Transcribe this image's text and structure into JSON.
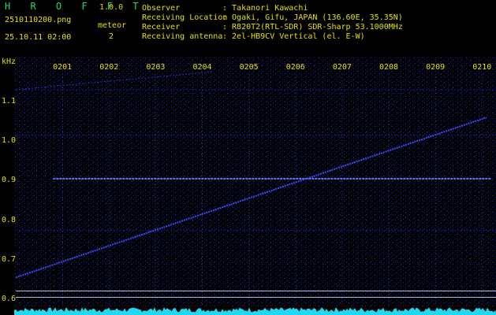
{
  "header": {
    "app_name": "H R O F F T",
    "version": "1.0.0",
    "filename": "2510110200.png",
    "datetime": "25.10.11 02:00",
    "meteor_label": "meteor",
    "meteor_count": "2",
    "info": [
      {
        "label": "Observer",
        "value": ": Takanori Kawachi"
      },
      {
        "label": "Receiving Location",
        "value": ": Ogaki, Gifu, JAPAN (136.60E, 35.35N)"
      },
      {
        "label": "Receiver",
        "value": ": R820T2(RTL-SDR) SDR-Sharp 53.1000MHz"
      },
      {
        "label": "Receiving antenna",
        "value": ": 2el-HB9CV Vertical (el. E-W)"
      }
    ]
  },
  "colors": {
    "background": "#000000",
    "label_text": "#e6e000",
    "title_green": "#23d96f",
    "signal_blue": "#3a4cff",
    "grid_purple": "#5a3fc0",
    "baseline_cyan": "#20d8f0"
  },
  "chart_data": {
    "type": "heatmap",
    "y_unit_label": "kHz",
    "y_ticks": [
      "1.1",
      "1.0",
      "0.9",
      "0.8",
      "0.7",
      "0.6"
    ],
    "y_tick_values": [
      1.1,
      1.0,
      0.9,
      0.8,
      0.7,
      0.6
    ],
    "ylim": [
      0.585,
      1.175
    ],
    "x_ticks": [
      "0201",
      "0202",
      "0203",
      "0204",
      "0205",
      "0206",
      "0207",
      "0208",
      "0209",
      "0210"
    ],
    "x_tick_positions_min": [
      1,
      2,
      3,
      4,
      5,
      6,
      7,
      8,
      9,
      10
    ],
    "xlim_min": [
      0,
      10.3
    ],
    "features": {
      "horizontal_carrier_khz": 0.905,
      "faint_carriers_khz": [
        1.13,
        1.015,
        0.775
      ],
      "drifting_signal": [
        [
          0.0,
          0.655
        ],
        [
          10.1,
          1.06
        ]
      ],
      "upper_drift": [
        [
          0.0,
          1.13
        ],
        [
          4.2,
          1.175
        ]
      ],
      "reference_lines_khz": [
        0.621,
        0.605
      ]
    }
  }
}
